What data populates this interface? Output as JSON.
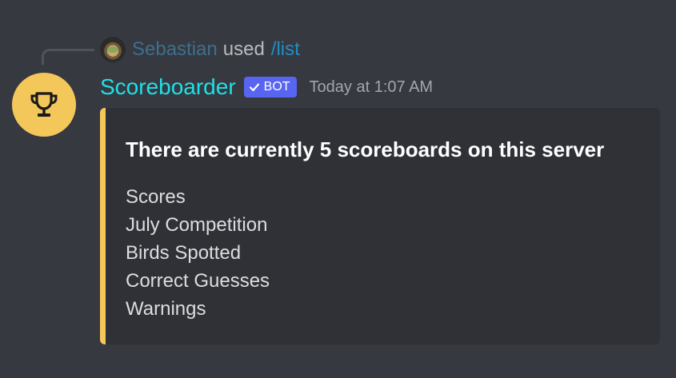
{
  "reply": {
    "username": "Sebastian",
    "used_text": "used",
    "command": "/list"
  },
  "message": {
    "username": "Scoreboarder",
    "bot_tag": "BOT",
    "timestamp": "Today at 1:07 AM",
    "avatar_icon": "trophy-icon",
    "embed": {
      "title": "There are currently 5 scoreboards on this server",
      "accent_color": "#f4c75a",
      "items": [
        "Scores",
        "July Competition",
        "Birds Spotted",
        "Correct Guesses",
        "Warnings"
      ]
    }
  },
  "colors": {
    "background": "#36393f",
    "embed_background": "#2f3136",
    "bot_tag": "#5865f2",
    "username": "#1fe0e8"
  }
}
